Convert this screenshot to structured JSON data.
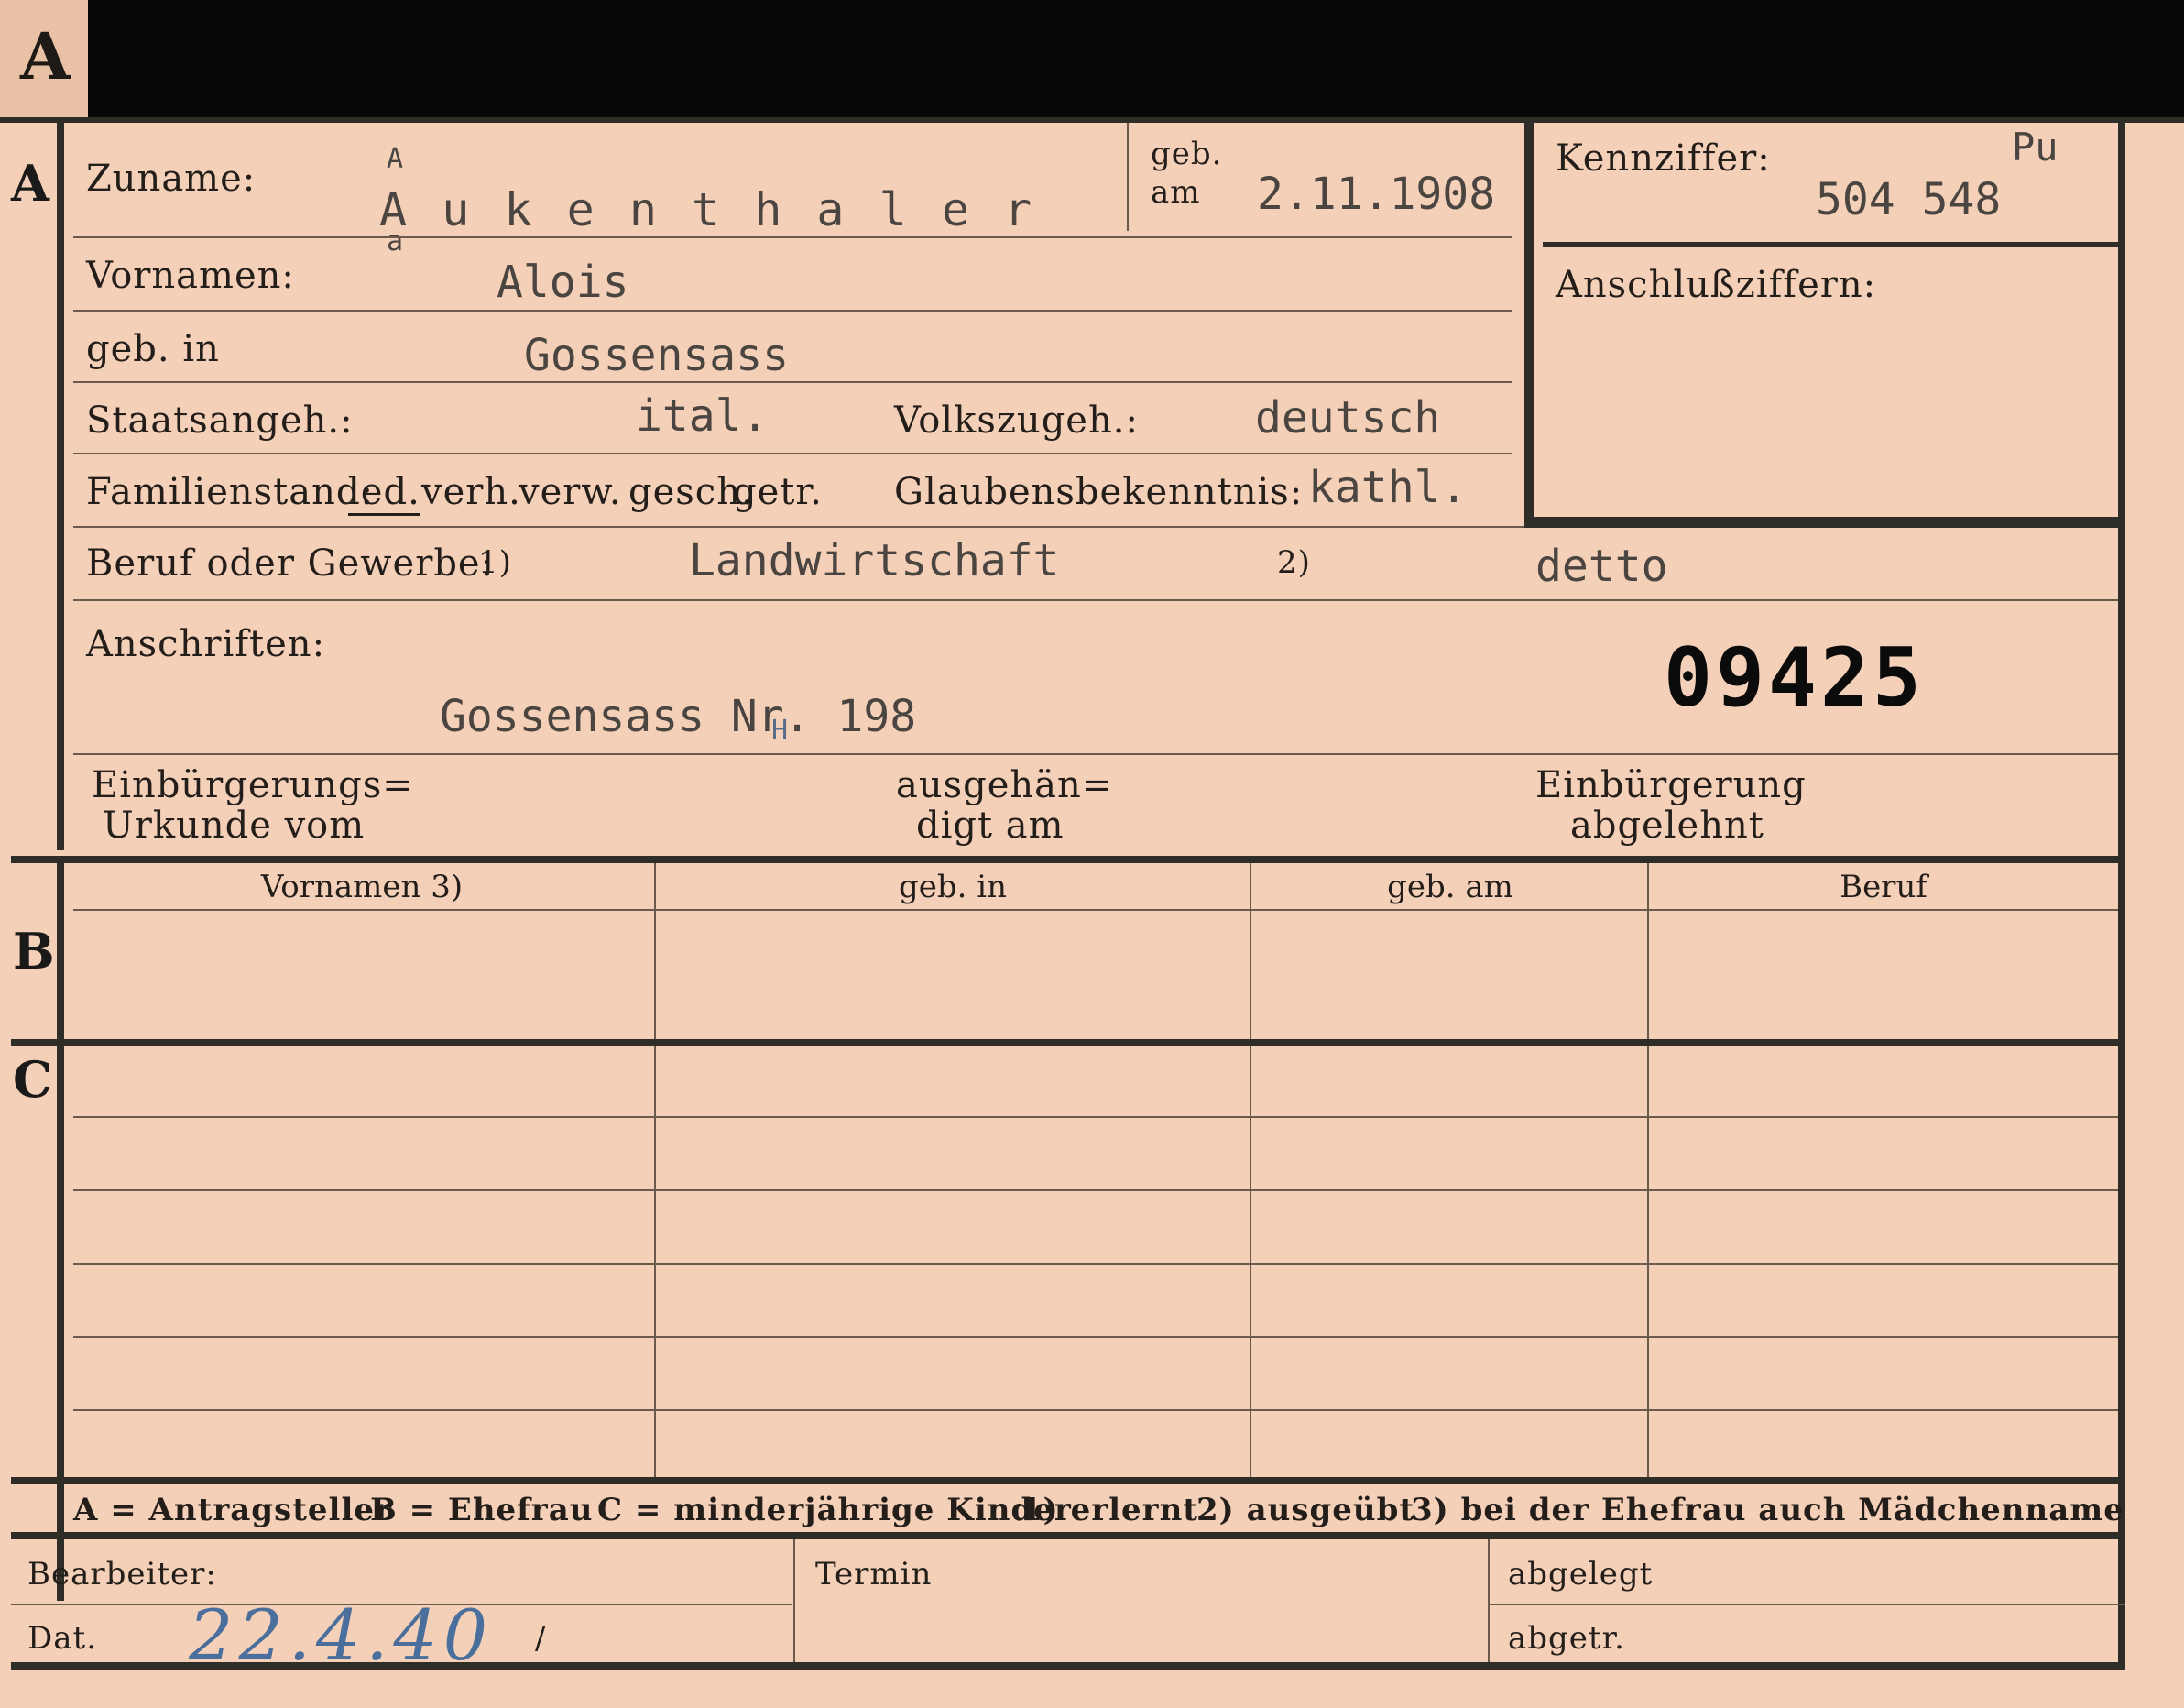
{
  "corner_tab": "A",
  "section_a": {
    "letter": "A",
    "surname_label": "Zuname:",
    "surname_value": "A u k e n t h a l e r",
    "surname_correction_top": "A",
    "surname_correction_below": "a",
    "birth_label_1": "geb.",
    "birth_label_2": "am",
    "birth_date_value": "2.11.1908",
    "id_label": "Kennziffer:",
    "id_prefix": "Pu",
    "id_value": "504 548",
    "connection_label": "Anschlußziffern:",
    "first_names_label": "Vornamen:",
    "first_names_value": "Alois",
    "birthplace_label": "geb. in",
    "birthplace_value": "Gossensass",
    "citizenship_label": "Staatsangeh.:",
    "citizenship_value": "ital.",
    "ethnicity_label": "Volkszugeh.:",
    "ethnicity_value": "deutsch",
    "marital_label": "Familienstand:",
    "marital_options": [
      "led.",
      "verh.",
      "verw.",
      "gesch.",
      "getr."
    ],
    "religion_label": "Glaubensbekenntnis:",
    "religion_value": "kathl.",
    "occupation_label": "Beruf oder Gewerbe:",
    "occupation_note_1": "1)",
    "occupation_value_1": "Landwirtschaft",
    "occupation_note_2": "2)",
    "occupation_value_2": "detto",
    "address_label": "Anschriften:",
    "address_value": "Gossensass Nr. 198",
    "address_correction": "H",
    "stamp_number": "09425",
    "naturalization_label_1": "Einbürgerungs=",
    "naturalization_label_2": "Urkunde vom",
    "handed_label_1": "ausgehän=",
    "handed_label_2": "digt am",
    "rejected_label_1": "Einbürgerung",
    "rejected_label_2": "abgelehnt"
  },
  "section_b": {
    "letter": "B",
    "columns": [
      "Vornamen 3)",
      "geb. in",
      "geb. am",
      "Beruf"
    ]
  },
  "section_c": {
    "letter": "C"
  },
  "legend": {
    "items": [
      "A = Antragsteller",
      "B = Ehefrau",
      "C = minderjährige Kinder",
      "1) erlernt",
      "2) ausgeübt",
      "3) bei der Ehefrau auch Mädchenname"
    ]
  },
  "footer": {
    "processor_label": "Bearbeiter:",
    "date_label": "Dat.",
    "date_value": "22.4.40",
    "date_slash": "/",
    "deadline_label": "Termin",
    "filed_label": "abgelegt",
    "removed_label": "abgetr."
  }
}
